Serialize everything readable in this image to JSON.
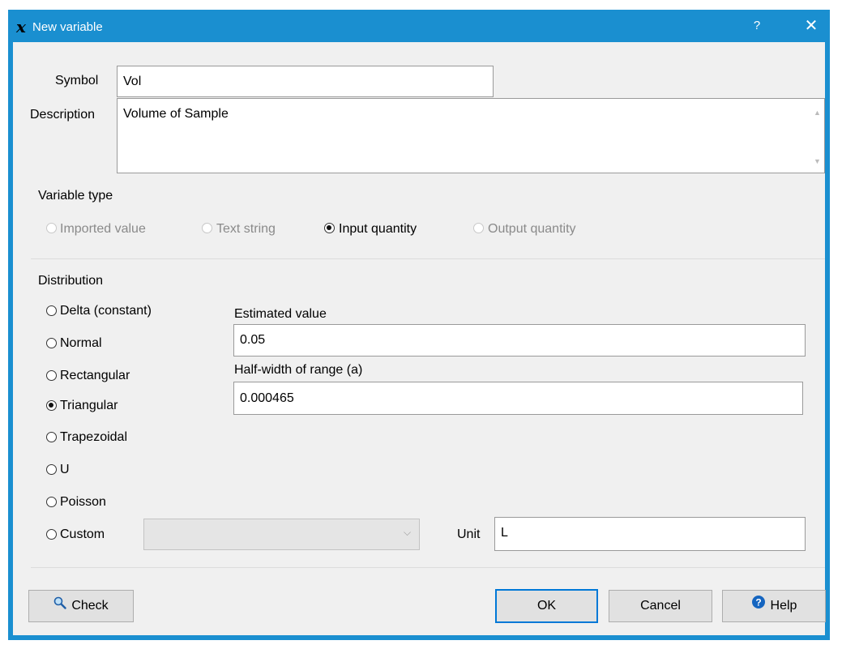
{
  "window": {
    "title": "New variable",
    "app_icon": "x-script-icon",
    "help_glyph": "?",
    "close_glyph": "✕"
  },
  "form": {
    "symbol_label": "Symbol",
    "symbol_value": "Vol",
    "description_label": "Description",
    "description_value": "Volume of Sample"
  },
  "variable_type": {
    "heading": "Variable type",
    "options": [
      {
        "label": "Imported value",
        "selected": false,
        "enabled": false
      },
      {
        "label": "Text string",
        "selected": false,
        "enabled": false
      },
      {
        "label": "Input quantity",
        "selected": true,
        "enabled": true
      },
      {
        "label": "Output quantity",
        "selected": false,
        "enabled": false
      }
    ]
  },
  "distribution": {
    "heading": "Distribution",
    "options": [
      {
        "label": "Delta (constant)",
        "selected": false
      },
      {
        "label": "Normal",
        "selected": false
      },
      {
        "label": "Rectangular",
        "selected": false
      },
      {
        "label": "Triangular",
        "selected": true
      },
      {
        "label": "Trapezoidal",
        "selected": false
      },
      {
        "label": "U",
        "selected": false
      },
      {
        "label": "Poisson",
        "selected": false
      },
      {
        "label": "Custom",
        "selected": false
      }
    ],
    "estimated_value_label": "Estimated value",
    "estimated_value": "0.05",
    "half_width_label": "Half-width of range (a)",
    "half_width_value": "0.000465",
    "custom_select_value": "",
    "unit_label": "Unit",
    "unit_value": "L"
  },
  "buttons": {
    "check": "Check",
    "ok": "OK",
    "cancel": "Cancel",
    "help": "Help"
  },
  "colors": {
    "title_bar": "#1a8fd0",
    "default_button_border": "#0078d7",
    "help_icon": "#1565c0"
  }
}
